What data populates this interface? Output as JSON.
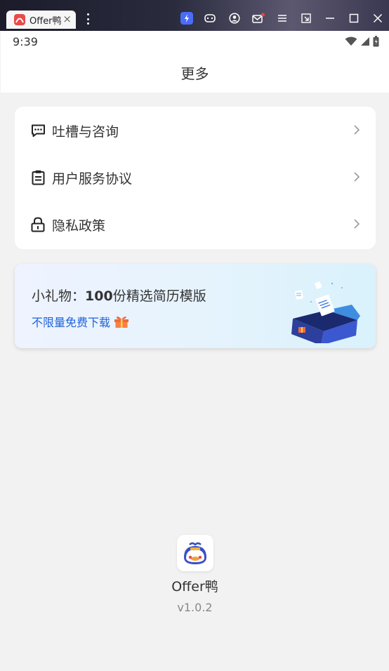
{
  "window": {
    "tab_label": "Offer鸭",
    "tab_close": "×",
    "toolbar_icons": [
      "boost-icon",
      "gamepad-icon",
      "account-icon",
      "mail-icon",
      "menu-icon",
      "resize-window-icon",
      "minimize-icon",
      "maximize-icon",
      "close-icon"
    ]
  },
  "statusbar": {
    "time": "9:39"
  },
  "navbar": {
    "title": "更多"
  },
  "menu": {
    "items": [
      {
        "label": "吐槽与咨询",
        "icon": "chat-bubble-icon"
      },
      {
        "label": "用户服务协议",
        "icon": "clipboard-icon"
      },
      {
        "label": "隐私政策",
        "icon": "lock-icon"
      }
    ]
  },
  "gift_banner": {
    "title_prefix": "小礼物：",
    "title_number": "100",
    "title_suffix": "份精选简历模版",
    "subtitle": "不限量免费下载",
    "accent_color": "#1d63d8"
  },
  "about": {
    "app_name": "Offer鸭",
    "version": "v1.0.2"
  }
}
